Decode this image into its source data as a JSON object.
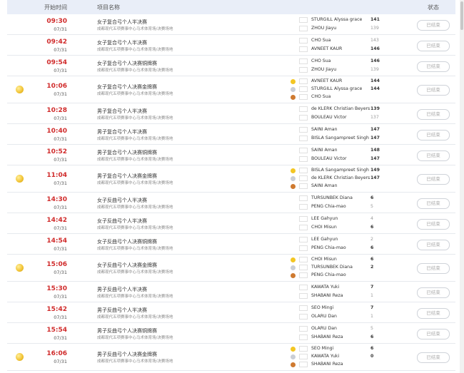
{
  "header": {
    "time_label": "开始时间",
    "event_label": "项目名称",
    "status_label": "状态"
  },
  "venue": "成都现代五项赛事中心马术体育场/决赛场地",
  "finished_label": "已结束",
  "rows": [
    {
      "medal": false,
      "time": "09:30",
      "date": "07/31",
      "event": "女子复合弓个人半决赛",
      "athletes": [
        {
          "flag": "usa",
          "name": "STURGILL Alyssa grace",
          "score": "141",
          "win": true
        },
        {
          "flag": "chn",
          "name": "ZHOU Jiayu",
          "score": "139",
          "win": false
        }
      ]
    },
    {
      "medal": false,
      "time": "09:42",
      "date": "07/31",
      "event": "女子复合弓个人半决赛",
      "athletes": [
        {
          "flag": "kor",
          "name": "CHO Sua",
          "score": "143",
          "win": false
        },
        {
          "flag": "ind",
          "name": "AVNEET KAUR",
          "score": "146",
          "win": true
        }
      ]
    },
    {
      "medal": false,
      "time": "09:54",
      "date": "07/31",
      "event": "女子复合弓个人决赛铜牌赛",
      "athletes": [
        {
          "flag": "kor",
          "name": "CHO Sua",
          "score": "146",
          "win": true
        },
        {
          "flag": "chn",
          "name": "ZHOU Jiayu",
          "score": "139",
          "win": false
        }
      ]
    },
    {
      "medal": true,
      "time": "10:06",
      "date": "07/31",
      "event": "女子复合弓个人决赛金牌赛",
      "athletes": [
        {
          "rank": "gold",
          "flag": "ind",
          "name": "AVNEET KAUR",
          "score": "144",
          "win": true
        },
        {
          "rank": "silver",
          "flag": "usa",
          "name": "STURGILL Alyssa grace",
          "score": "144",
          "win": true
        },
        {
          "rank": "bronze",
          "flag": "kor",
          "name": "CHO Sua",
          "score": "",
          "win": true
        }
      ]
    },
    {
      "medal": false,
      "time": "10:28",
      "date": "07/31",
      "event": "男子复合弓个人半决赛",
      "athletes": [
        {
          "flag": "rsa",
          "name": "de KLERK Christian Beyers",
          "score": "139",
          "win": true
        },
        {
          "flag": "fra",
          "name": "BOULEAU Victor",
          "score": "137",
          "win": false
        }
      ]
    },
    {
      "medal": false,
      "time": "10:40",
      "date": "07/31",
      "event": "男子复合弓个人半决赛",
      "athletes": [
        {
          "flag": "ind",
          "name": "SAINI Aman",
          "score": "147",
          "win": true
        },
        {
          "flag": "ind",
          "name": "BISLA Sangampreet Singh",
          "score": "147",
          "win": true
        }
      ]
    },
    {
      "medal": false,
      "time": "10:52",
      "date": "07/31",
      "event": "男子复合弓个人决赛铜牌赛",
      "athletes": [
        {
          "flag": "ind",
          "name": "SAINI Aman",
          "score": "148",
          "win": true
        },
        {
          "flag": "fra",
          "name": "BOULEAU Victor",
          "score": "147",
          "win": true
        }
      ]
    },
    {
      "medal": true,
      "time": "11:04",
      "date": "07/31",
      "event": "男子复合弓个人决赛金牌赛",
      "athletes": [
        {
          "rank": "gold",
          "flag": "ind",
          "name": "BISLA Sangampreet Singh",
          "score": "149",
          "win": true
        },
        {
          "rank": "silver",
          "flag": "rsa",
          "name": "de KLERK Christian Beyers",
          "score": "147",
          "win": true
        },
        {
          "rank": "bronze",
          "flag": "ind",
          "name": "SAINI Aman",
          "score": "",
          "win": true
        }
      ]
    },
    {
      "medal": false,
      "time": "14:30",
      "date": "07/31",
      "event": "女子反曲弓个人半决赛",
      "athletes": [
        {
          "flag": "kaz",
          "name": "TURSUNBEK Diana",
          "score": "6",
          "win": true
        },
        {
          "flag": "tpe",
          "name": "PENG Chia-mao",
          "score": "5",
          "win": false
        }
      ]
    },
    {
      "medal": false,
      "time": "14:42",
      "date": "07/31",
      "event": "女子反曲弓个人半决赛",
      "athletes": [
        {
          "flag": "kor",
          "name": "LEE Gahyun",
          "score": "4",
          "win": false
        },
        {
          "flag": "kor",
          "name": "CHOI Misun",
          "score": "6",
          "win": true
        }
      ]
    },
    {
      "medal": false,
      "time": "14:54",
      "date": "07/31",
      "event": "女子反曲弓个人决赛铜牌赛",
      "athletes": [
        {
          "flag": "kor",
          "name": "LEE Gahyun",
          "score": "2",
          "win": false
        },
        {
          "flag": "tpe",
          "name": "PENG Chia-mao",
          "score": "6",
          "win": true
        }
      ]
    },
    {
      "medal": true,
      "time": "15:06",
      "date": "07/31",
      "event": "女子反曲弓个人决赛金牌赛",
      "athletes": [
        {
          "rank": "gold",
          "flag": "kor",
          "name": "CHOI Misun",
          "score": "6",
          "win": true
        },
        {
          "rank": "silver",
          "flag": "kaz",
          "name": "TURSUNBEK Diana",
          "score": "2",
          "win": true
        },
        {
          "rank": "bronze",
          "flag": "tpe",
          "name": "PENG Chia-mao",
          "score": "",
          "win": true
        }
      ]
    },
    {
      "medal": false,
      "time": "15:30",
      "date": "07/31",
      "event": "男子反曲弓个人半决赛",
      "athletes": [
        {
          "flag": "jpn",
          "name": "KAWATA Yuki",
          "score": "7",
          "win": true
        },
        {
          "flag": "iri",
          "name": "SHABANI Reza",
          "score": "1",
          "win": false
        }
      ]
    },
    {
      "medal": false,
      "time": "15:42",
      "date": "07/31",
      "event": "男子反曲弓个人半决赛",
      "athletes": [
        {
          "flag": "kor",
          "name": "SEO Mingi",
          "score": "7",
          "win": true
        },
        {
          "flag": "mda",
          "name": "OLARU Dan",
          "score": "1",
          "win": false
        }
      ]
    },
    {
      "medal": false,
      "time": "15:54",
      "date": "07/31",
      "event": "男子反曲弓个人决赛铜牌赛",
      "athletes": [
        {
          "flag": "mda",
          "name": "OLARU Dan",
          "score": "5",
          "win": false
        },
        {
          "flag": "iri",
          "name": "SHABANI Reza",
          "score": "6",
          "win": true
        }
      ]
    },
    {
      "medal": true,
      "time": "16:06",
      "date": "07/31",
      "event": "男子反曲弓个人决赛金牌赛",
      "athletes": [
        {
          "rank": "gold",
          "flag": "kor",
          "name": "SEO Mingi",
          "score": "6",
          "win": true
        },
        {
          "rank": "silver",
          "flag": "jpn",
          "name": "KAWATA Yuki",
          "score": "0",
          "win": true
        },
        {
          "rank": "bronze",
          "flag": "iri",
          "name": "SHABANI Reza",
          "score": "",
          "win": true
        }
      ]
    }
  ]
}
